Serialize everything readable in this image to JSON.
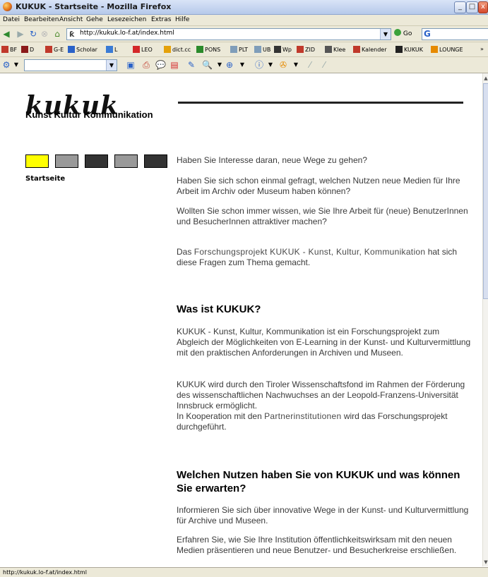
{
  "window": {
    "title": "KUKUK - Startseite - Mozilla Firefox"
  },
  "menu": [
    "Datei",
    "Bearbeiten",
    "Ansicht",
    "Gehe",
    "Lesezeichen",
    "Extras",
    "Hilfe"
  ],
  "navbar": {
    "url": "http://kukuk.lo-f.at/index.html",
    "go_label": "Go",
    "search_logo": "G"
  },
  "bookmarks": [
    {
      "label": "BF",
      "icon": "bookmark-icon",
      "color": "#c0392b"
    },
    {
      "label": "D",
      "icon": "d-icon",
      "color": "#8b1a1a"
    },
    {
      "label": "G-E",
      "icon": "dict-icon",
      "color": "#c0392b"
    },
    {
      "label": "Scholar",
      "icon": "google-icon",
      "color": "#2a62c8"
    },
    {
      "label": "L",
      "icon": "book-icon",
      "color": "#3a7bd5"
    },
    {
      "label": "LEO",
      "icon": "leo-icon",
      "color": "#d4282a"
    },
    {
      "label": "dict.cc",
      "icon": "dict-cc-icon",
      "color": "#e4a10b"
    },
    {
      "label": "PONS",
      "icon": "pons-icon",
      "color": "#2b8a2b"
    },
    {
      "label": "PLT",
      "icon": "page-icon",
      "color": "#7f9db9"
    },
    {
      "label": "UB",
      "icon": "page-icon",
      "color": "#7f9db9"
    },
    {
      "label": "Wp",
      "icon": "wikipedia-icon",
      "color": "#333333"
    },
    {
      "label": "ZID",
      "icon": "calendar-icon",
      "color": "#c0392b"
    },
    {
      "label": "Klee",
      "icon": "mountain-icon",
      "color": "#555555"
    },
    {
      "label": "Kalender",
      "icon": "calendar-icon",
      "color": "#c0392b"
    },
    {
      "label": "KUKUK",
      "icon": "kukuk-icon",
      "color": "#222222"
    },
    {
      "label": "LOUNGE",
      "icon": "lounge-icon",
      "color": "#e68a00"
    }
  ],
  "page": {
    "logo_text": "kukuk",
    "logo_subtitle": "Kunst Kultur Kommunikation",
    "nav_colors": [
      "#ffff00",
      "#999999",
      "#333333",
      "#999999",
      "#333333"
    ],
    "sidenav_label": "Startseite",
    "intro": [
      "Haben Sie Interesse daran, neue Wege zu gehen?",
      "Haben Sie sich schon einmal gefragt, welchen Nutzen neue Medien für Ihre Arbeit im Archiv oder Museum haben können?",
      "Wollten Sie schon immer wissen, wie Sie Ihre Arbeit für (neue) BenutzerInnen und BesucherInnen attraktiver machen?"
    ],
    "project_pre": "Das ",
    "project_link": "Forschungsprojekt KUKUK - Kunst, Kultur, Kommunikation",
    "project_post": " hat sich diese Fragen zum Thema gemacht.",
    "heading1": "Was ist KUKUK?",
    "what_p1": "KUKUK - Kunst, Kultur, Kommunikation ist ein Forschungsprojekt zum Abgleich der Möglichkeiten von E-Learning in der Kunst- und Kulturvermittlung mit den praktischen Anforderungen in Archiven und Museen.",
    "what_p2_a": "KUKUK wird durch den Tiroler Wissenschaftsfond im Rahmen der Förderung des wissenschaftlichen Nachwuchses an der Leopold-Franzens-Universität Innsbruck ermöglicht.",
    "what_p2_b_pre": "In Kooperation mit den ",
    "what_p2_b_link": "Partnerinstitutionen",
    "what_p2_b_post": " wird das Forschungsprojekt durchgeführt.",
    "heading2": "Welchen Nutzen haben Sie von KUKUK und was können Sie erwarten?",
    "benefit_p1": "Informieren Sie sich über innovative Wege in der Kunst- und Kulturvermittlung für Archive und Museen.",
    "benefit_p2": "Erfahren Sie, wie Sie Ihre Institution öffentlichkeitswirksam mit den neuen Medien präsentieren und neue Benutzer- und Besucherkreise erschließen."
  },
  "status": "http://kukuk.lo-f.at/index.html"
}
